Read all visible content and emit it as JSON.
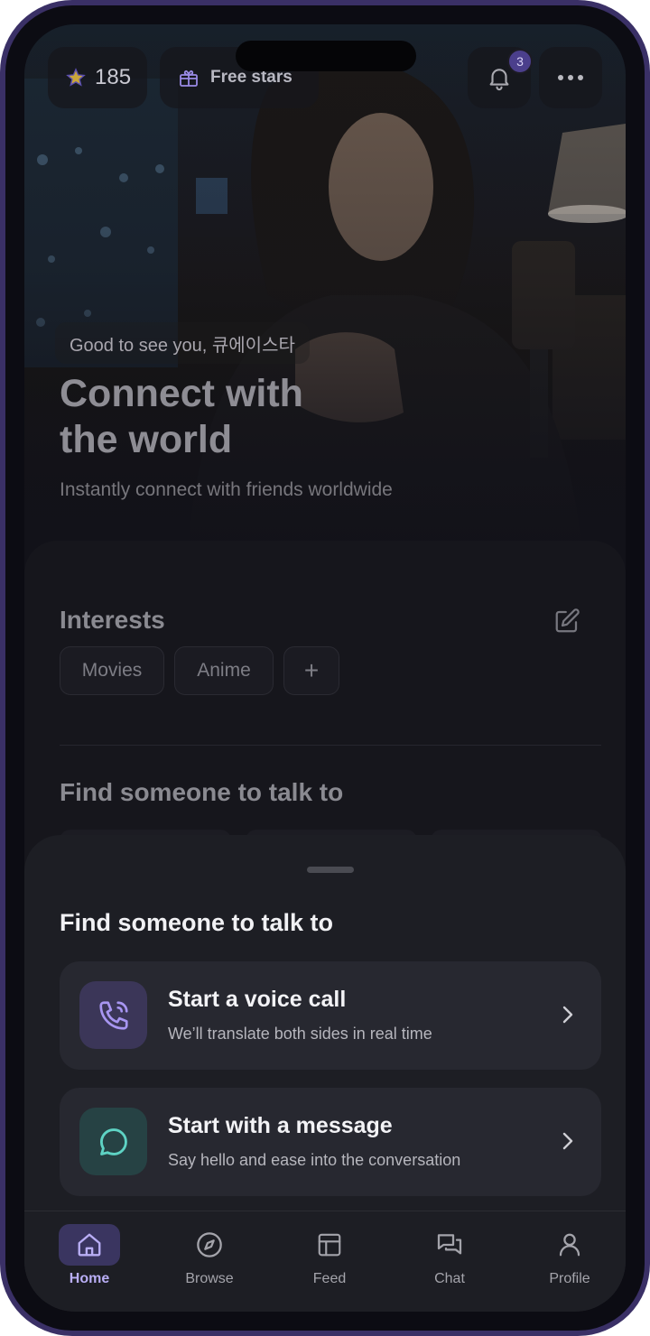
{
  "header": {
    "stars_count": "185",
    "free_stars_label": "Free stars",
    "notification_count": "3"
  },
  "hero": {
    "greeting": "Good to see you, 큐에이스타",
    "title_line1": "Connect with",
    "title_line2": "the world",
    "subtitle": "Instantly connect with friends worldwide"
  },
  "interests": {
    "title": "Interests",
    "chips": [
      "Movies",
      "Anime"
    ],
    "add_symbol": "+"
  },
  "find_section": {
    "title": "Find someone to talk to"
  },
  "sheet": {
    "title": "Find someone to talk to",
    "options": [
      {
        "title": "Start a voice call",
        "subtitle": "We’ll translate both sides in real time",
        "icon": "phone-call-icon",
        "accent": "#a896f2"
      },
      {
        "title": "Start with a message",
        "subtitle": "Say hello and ease into the conversation",
        "icon": "chat-bubble-icon",
        "accent": "#5ed3c4"
      }
    ]
  },
  "tabbar": {
    "items": [
      {
        "label": "Home",
        "icon": "home-icon",
        "active": true
      },
      {
        "label": "Browse",
        "icon": "compass-icon",
        "active": false
      },
      {
        "label": "Feed",
        "icon": "layout-icon",
        "active": false
      },
      {
        "label": "Chat",
        "icon": "chat-icon",
        "active": false
      },
      {
        "label": "Profile",
        "icon": "user-icon",
        "active": false
      }
    ]
  },
  "colors": {
    "accent": "#b9aef5",
    "background": "#121219",
    "sheet": "#1d1e24"
  }
}
